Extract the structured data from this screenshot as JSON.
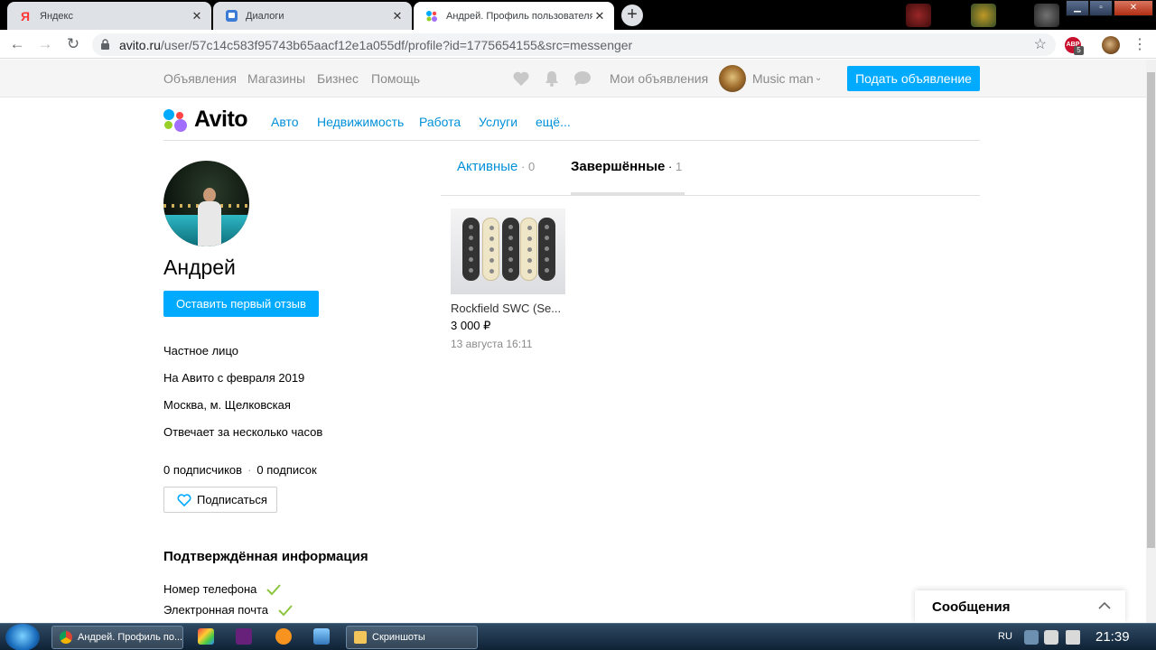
{
  "browser": {
    "tabs": [
      {
        "title": "Яндекс",
        "icon": "yandex-icon"
      },
      {
        "title": "Диалоги",
        "icon": "chat-icon"
      },
      {
        "title": "Андрей. Профиль пользователя н",
        "icon": "avito-icon"
      }
    ],
    "url_host": "avito.ru",
    "url_path": "/user/57c14c583f95743b65aacf12e1a055df/profile?id=1775654155&src=messenger",
    "extension_badge": "5",
    "extension_label": "ABP"
  },
  "topbar": {
    "links": [
      "Объявления",
      "Магазины",
      "Бизнес",
      "Помощь"
    ],
    "my_ads": "Мои объявления",
    "user_name": "Music man",
    "post_button": "Подать объявление"
  },
  "nav": {
    "logo": "Avito",
    "links": [
      "Авто",
      "Недвижимость",
      "Работа",
      "Услуги",
      "ещё..."
    ]
  },
  "profile": {
    "name": "Андрей",
    "review_button": "Оставить первый отзыв",
    "info": [
      "Частное лицо",
      "На Авито с февраля 2019",
      "Москва, м. Щелковская",
      "Отвечает за несколько часов"
    ],
    "subscribers": "0 подписчиков",
    "subscriptions": "0 подписок",
    "separator": "·",
    "subscribe_button": "Подписаться",
    "verified_title": "Подтверждённая информация",
    "verified_items": [
      "Номер телефона",
      "Электронная почта"
    ]
  },
  "listing_tabs": {
    "active": {
      "label": "Активные",
      "sep": " · ",
      "count": "0"
    },
    "completed": {
      "label": "Завершённые",
      "sep": " · ",
      "count": "1"
    }
  },
  "items": [
    {
      "title": "Rockfield SWC (Se...",
      "price": "3 000 ₽",
      "date": "13 августа 16:11"
    }
  ],
  "messages_panel": {
    "label": "Сообщения"
  },
  "taskbar": {
    "apps": [
      {
        "label": "Андрей. Профиль по..."
      },
      {
        "label": "Скриншоты"
      }
    ],
    "language": "RU",
    "time": "21:39"
  },
  "colors": {
    "accent": "#00aaff",
    "link": "#0091d9",
    "check": "#8cc63f"
  }
}
